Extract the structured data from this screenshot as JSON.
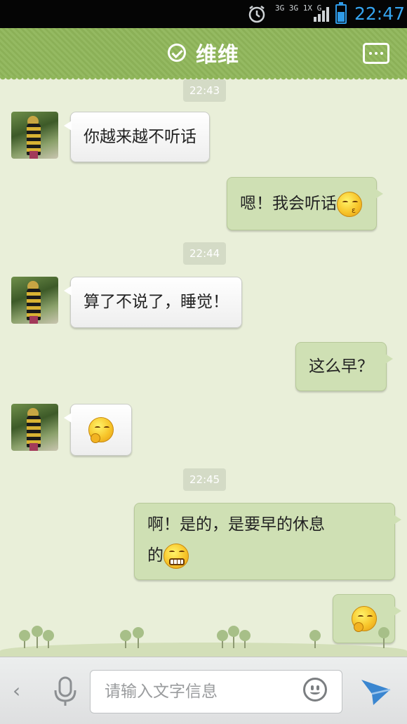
{
  "status_bar": {
    "network": "3G 3G 1X G",
    "clock": "22:47",
    "battery_level": 0.6
  },
  "header": {
    "title": "维维"
  },
  "messages": [
    {
      "time": "22:43"
    },
    {
      "from": "contact",
      "text": "你越来越不听话"
    },
    {
      "from": "me",
      "text": "嗯！我会听话",
      "emoji": "kissing-emoji"
    },
    {
      "time": "22:44"
    },
    {
      "from": "contact",
      "text": "算了不说了，睡觉！"
    },
    {
      "from": "me",
      "text": "这么早？"
    },
    {
      "from": "contact",
      "text": "",
      "emoji": "thinking-emoji"
    },
    {
      "time": "22:45"
    },
    {
      "from": "me",
      "line1": "啊！是的，是要早的休息",
      "line2": "的",
      "emoji": "grinning-emoji"
    },
    {
      "from": "me",
      "text": "",
      "emoji": "thinking-emoji"
    }
  ],
  "input": {
    "placeholder": "请输入文字信息"
  },
  "icons": {
    "back": "chevron-left-icon",
    "mic": "microphone-icon",
    "emoji": "smiley-icon",
    "send": "send-arrow-icon",
    "more": "more-dots-icon",
    "online": "check-circle-icon"
  },
  "colors": {
    "header": "#8fb65a",
    "my_bubble": "#cfe0b4",
    "clock": "#35a5f0"
  }
}
